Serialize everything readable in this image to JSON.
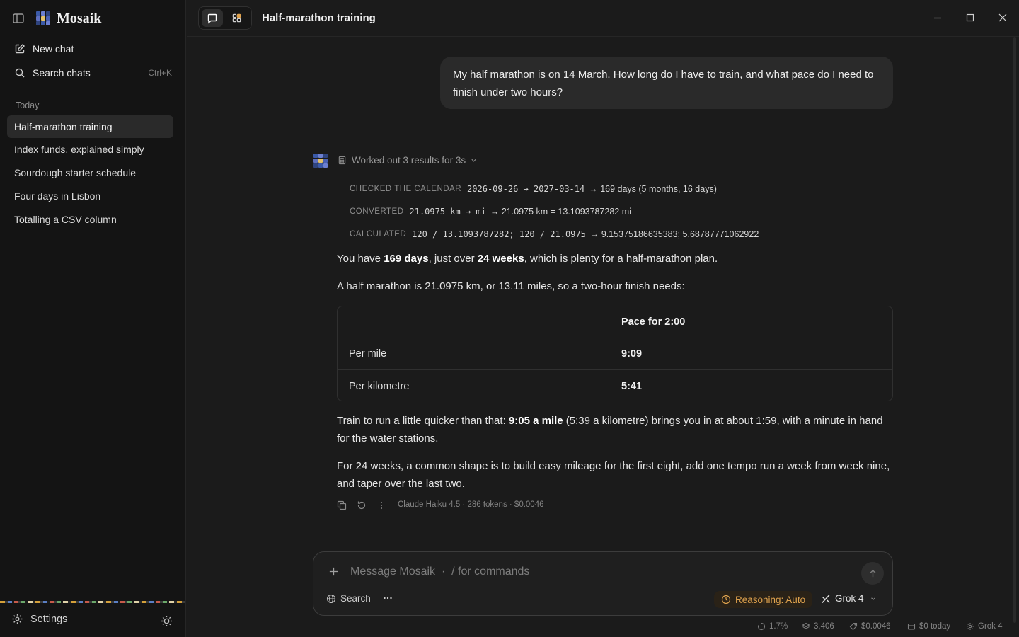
{
  "app": {
    "name": "Mosaik"
  },
  "sidebar": {
    "new_chat": "New chat",
    "search_chats": "Search chats",
    "search_shortcut": "Ctrl+K",
    "section_today": "Today",
    "chats": [
      {
        "label": "Half-marathon training",
        "active": true
      },
      {
        "label": "Index funds, explained simply"
      },
      {
        "label": "Sourdough starter schedule"
      },
      {
        "label": "Four days in Lisbon"
      },
      {
        "label": "Totalling a CSV column"
      }
    ],
    "settings": "Settings"
  },
  "header": {
    "title": "Half-marathon training"
  },
  "conversation": {
    "user_message": "My half marathon is on 14 March. How long do I have to train, and what pace do I need to finish under two hours?",
    "worked_summary": "Worked out 3 results for 3s",
    "tool_calls": [
      {
        "label": "CHECKED THE CALENDAR",
        "code": "2026-09-26 → 2027-03-14",
        "result": "→ 169 days (5 months, 16 days)"
      },
      {
        "label": "CONVERTED",
        "code": "21.0975 km → mi",
        "result": "→ 21.0975 km = 13.1093787282 mi"
      },
      {
        "label": "CALCULATED",
        "code": "120 / 13.1093787282; 120 / 21.0975",
        "result": "→ 9.15375186635383; 5.68787771062922"
      }
    ],
    "p1": {
      "a": "You have ",
      "b": "169 days",
      "c": ", just over ",
      "d": "24 weeks",
      "e": ", which is plenty for a half-marathon plan."
    },
    "p2": "A half marathon is 21.0975 km, or 13.11 miles, so a two-hour finish needs:",
    "table": {
      "header": [
        "",
        "Pace for 2:00"
      ],
      "rows": [
        [
          "Per mile",
          "9:09"
        ],
        [
          "Per kilometre",
          "5:41"
        ]
      ]
    },
    "p3": {
      "a": "Train to run a little quicker than that: ",
      "b": "9:05 a mile",
      "c": " (5:39 a kilometre) brings you in at about 1:59, with a minute in hand for the water stations."
    },
    "p4": "For 24 weeks, a common shape is to build easy mileage for the first eight, add one tempo run a week from week nine, and taper over the last two.",
    "meta": "Claude Haiku 4.5 · 286 tokens · $0.0046"
  },
  "composer": {
    "placeholder": "Message Mosaik  ·  / for commands",
    "search": "Search",
    "reasoning": "Reasoning: Auto",
    "model": "Grok 4"
  },
  "statusbar": {
    "context": "1.7%",
    "tokens": "3,406",
    "cost": "$0.0046",
    "today": "$0 today",
    "model": "Grok 4"
  },
  "colors": {
    "accent_reasoning": "#e0a34e",
    "background": "#1b1b1b",
    "sidebar": "#141414"
  }
}
